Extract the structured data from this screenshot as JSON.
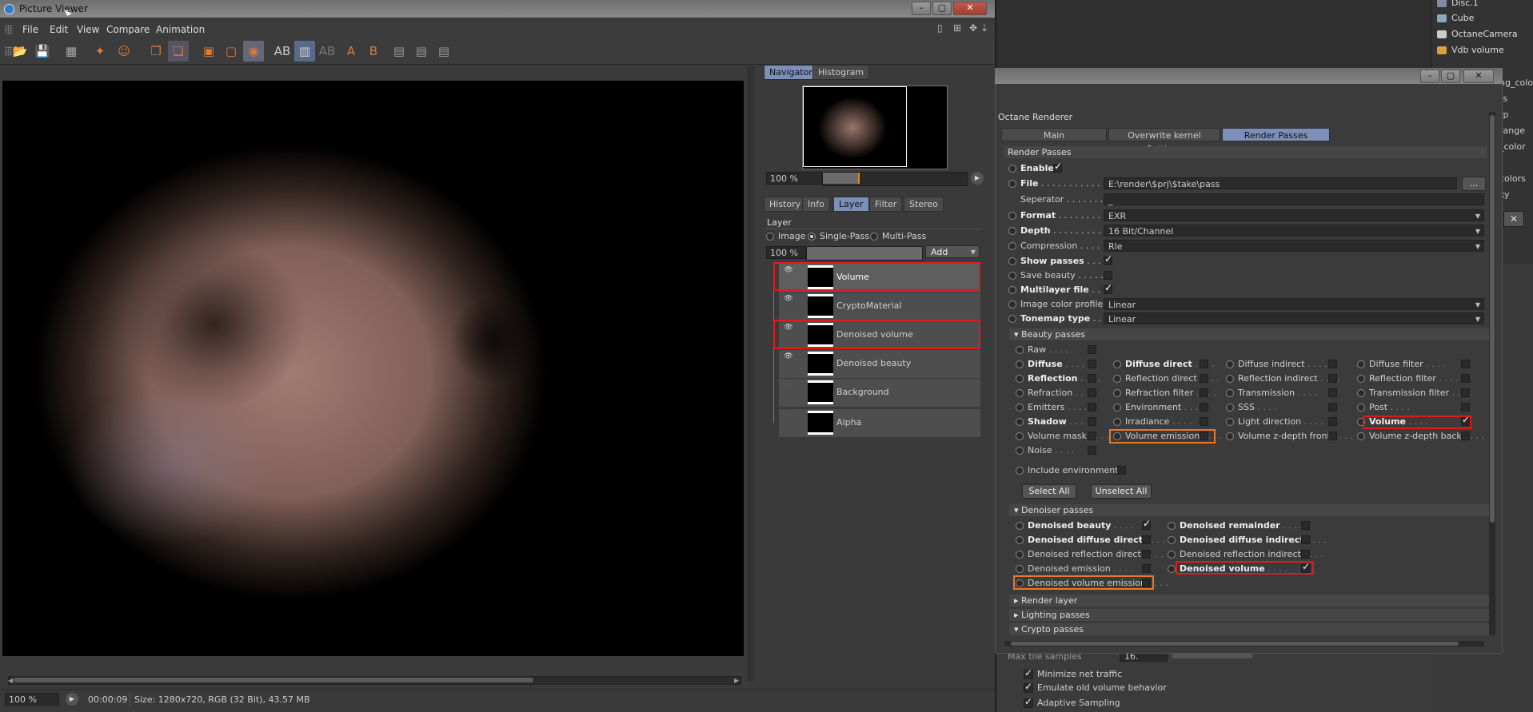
{
  "background": {
    "object_manager": {
      "items": [
        "Disc.1",
        "Cube",
        "OctaneCamera",
        "Vdb volume"
      ]
    },
    "fragments": [
      "ng_colo",
      "ts",
      "rp",
      "range",
      "_color",
      "colors",
      "ky"
    ],
    "bottom_panel": {
      "max_samples_label": "Max tile samples",
      "max_samples_value": "16.",
      "minimize_net_traffic": "Minimize net traffic",
      "emulate_old_volume": "Emulate old volume behavior",
      "adaptive_sampling": "Adaptive Sampling"
    }
  },
  "picture_viewer": {
    "title": "Picture Viewer",
    "menu": [
      "File",
      "Edit",
      "View",
      "Compare",
      "Animation"
    ],
    "statusbar": {
      "zoom": "100 %",
      "time": "00:00:09",
      "size_info": "Size: 1280x720, RGB (32 Bit), 43.57 MB"
    },
    "navigator": {
      "tabs": [
        "Navigator",
        "Histogram"
      ],
      "zoom": "100 %"
    },
    "side_tabs": [
      "History",
      "Info",
      "Layer",
      "Filter",
      "Stereo"
    ],
    "layer_panel": {
      "title": "Layer",
      "modes": [
        "Image",
        "Single-Pass",
        "Multi-Pass"
      ],
      "zoom": "100 %",
      "add_label": "Add",
      "layers": [
        "Volume",
        "CryptoMaterial",
        "Denoised volume",
        "Denoised beauty",
        "Background",
        "Alpha"
      ]
    }
  },
  "octane": {
    "title": "Octane Renderer",
    "tabs": [
      "Main",
      "Overwrite kernel Settings",
      "Render Passes"
    ],
    "section_title": "Render Passes",
    "settings": {
      "enable": "Enable",
      "file_label": "File",
      "file_value": "E:\\render\\$prj\\$take\\pass",
      "file_button": "...",
      "separator_label": "Seperator",
      "separator_value": "_",
      "format_label": "Format",
      "format_value": "EXR",
      "depth_label": "Depth",
      "depth_value": "16 Bit/Channel",
      "compression_label": "Compression",
      "compression_value": "Rle",
      "show_passes": "Show passes",
      "save_beauty": "Save beauty",
      "multilayer": "Multilayer file",
      "image_color_profile": "Image color profile",
      "image_color_profile_value": "Linear",
      "tonemap_type": "Tonemap type",
      "tonemap_value": "Linear"
    },
    "beauty_passes_title": "Beauty passes",
    "beauty_passes": [
      [
        "Raw"
      ],
      [
        "Diffuse",
        "Diffuse direct",
        "Diffuse indirect",
        "Diffuse filter"
      ],
      [
        "Reflection",
        "Reflection direct",
        "Reflection indirect",
        "Reflection filter"
      ],
      [
        "Refraction",
        "Refraction filter",
        "Transmission",
        "Transmission filter"
      ],
      [
        "Emitters",
        "Environment",
        "SSS",
        "Post"
      ],
      [
        "Shadow",
        "Irradiance",
        "Light direction",
        "Volume"
      ],
      [
        "Volume mask",
        "Volume emission",
        "Volume z-depth front",
        "Volume z-depth back"
      ],
      [
        "Noise"
      ]
    ],
    "include_environment": "Include environment",
    "select_all": "Select All",
    "unselect_all": "Unselect All",
    "denoiser_title": "Denoiser passes",
    "denoiser_left": [
      "Denoised beauty",
      "Denoised diffuse direct",
      "Denoised reflection direct",
      "Denoised emission",
      "Denoised volume emission"
    ],
    "denoiser_right": [
      "Denoised remainder",
      "Denoised diffuse indirect",
      "Denoised reflection indirect",
      "Denoised volume"
    ],
    "collapsed_sections": [
      "Render layer",
      "Lighting passes",
      "Crypto passes"
    ]
  },
  "colors": {
    "highlight_red": "#e01b1b",
    "highlight_orange": "#e8782a",
    "active_tab": "#7c8fb8"
  }
}
